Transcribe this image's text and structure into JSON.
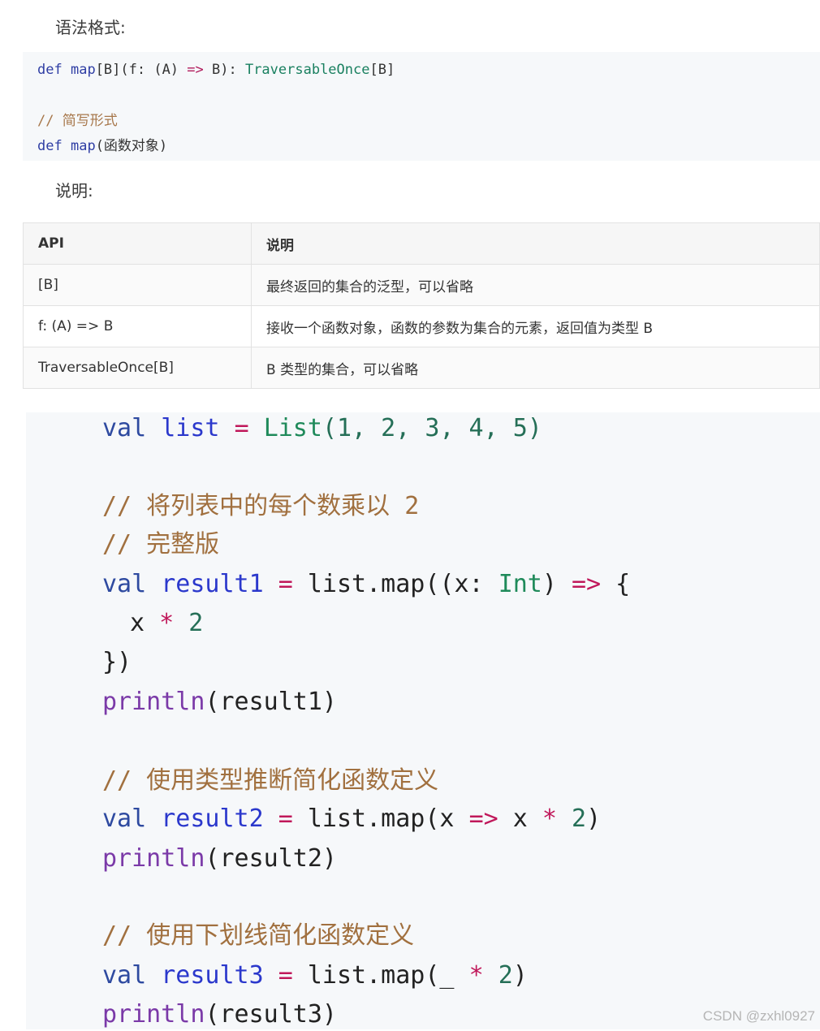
{
  "labels": {
    "syntax": "语法格式:",
    "desc": "说明:"
  },
  "code1": {
    "l1": {
      "kw": "def",
      "fn": "map",
      "a": "[B](f: (A) ",
      "op": "=>",
      "b": " B): ",
      "ty": "TraversableOnce",
      "c": "[B]"
    },
    "l2": "// 简写形式",
    "l3": {
      "kw": "def",
      "fn": "map",
      "a": "(函数对象)"
    }
  },
  "table": {
    "headers": [
      "API",
      "说明"
    ],
    "rows": [
      [
        "[B]",
        "最终返回的集合的泛型，可以省略"
      ],
      [
        "f: (A) => B",
        "接收一个函数对象，函数的参数为集合的元素，返回值为类型 B"
      ],
      [
        "TraversableOnce[B]",
        "B 类型的集合，可以省略"
      ]
    ]
  },
  "code2": {
    "val": "val",
    "list": "list",
    "eq": "=",
    "List": "List",
    "listArgs": "(1, 2, 3, 4, 5)",
    "c1": "// 将列表中的每个数乘以 2",
    "c2": "// 完整版",
    "r1": "result1",
    "map1a": "list.map((x: ",
    "Int": "Int",
    "map1b": ") ",
    "arrow": "=>",
    "brace": " {",
    "x": "x",
    "star": "*",
    "two": "2",
    "close": "})",
    "println": "println",
    "p1": "(result1)",
    "c3": "// 使用类型推断简化函数定义",
    "r2": "result2",
    "map2a": "list.map(x ",
    "map2b": " x ",
    "paren": ")",
    "p2": "(result2)",
    "c4": "// 使用下划线简化函数定义",
    "r3": "result3",
    "map3a": "list.map(_ ",
    "p3": "(result3)"
  },
  "watermark": "CSDN @zxhl0927"
}
